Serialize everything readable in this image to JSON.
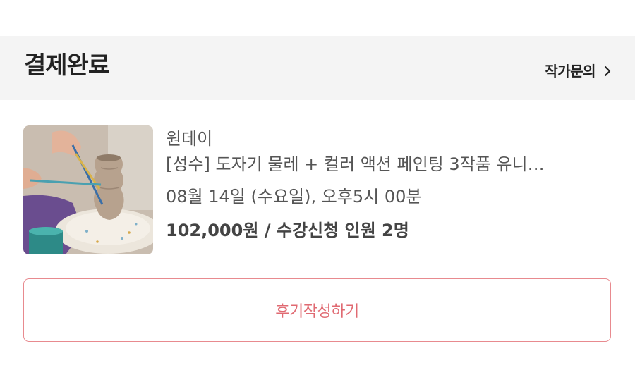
{
  "header": {
    "title": "결제완료",
    "inquiry_label": "작가문의"
  },
  "order": {
    "category": "원데이",
    "title": "[성수] 도자기 물레 + 컬러 액션 페인팅 3작품 유니…",
    "schedule": "08월 14일 (수요일), 오후5시 00분",
    "price_summary": "102,000원 / 수강신청 인원 2명"
  },
  "actions": {
    "review_label": "후기작성하기"
  },
  "colors": {
    "header_bg": "#f4f4f4",
    "accent": "#e06a72",
    "button_border": "#e88a8f"
  },
  "icons": {
    "inquiry_chevron": "chevron-right-icon"
  }
}
